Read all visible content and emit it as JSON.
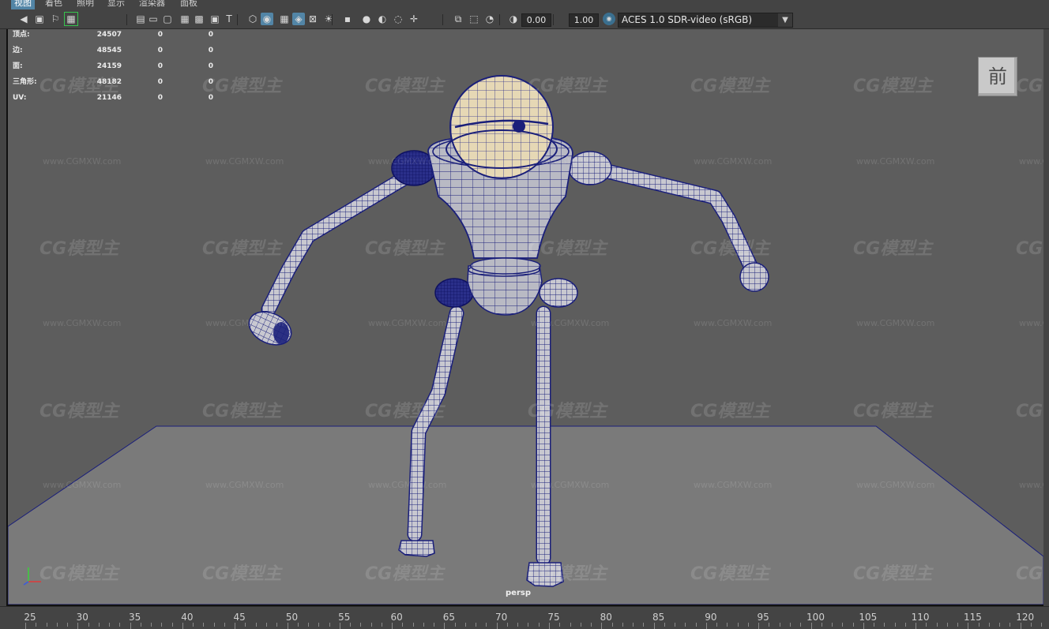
{
  "menu": {
    "items": [
      {
        "label": "视图",
        "active": true
      },
      {
        "label": "着色",
        "active": false
      },
      {
        "label": "照明",
        "active": false
      },
      {
        "label": "显示",
        "active": false
      },
      {
        "label": "渲染器",
        "active": false
      },
      {
        "label": "面板",
        "active": false
      }
    ]
  },
  "toolbar": {
    "icons": [
      "camera-icon",
      "camera-attributes-icon",
      "bookmark-icon",
      "image-plane-icon",
      "grid-icon",
      "film-gate-icon",
      "resolution-gate-icon",
      "safe-action-icon",
      "gate-mask-icon",
      "field-chart-icon",
      "safe-title-icon",
      "wireframe-icon",
      "smooth-shade-icon",
      "textured-icon",
      "shaded-wireframe-icon",
      "xray-icon",
      "lights-icon",
      "shadows-icon",
      "ambient-occlusion-icon",
      "motion-blur-icon",
      "isolate-select-icon",
      "xray-joints-icon",
      "frame-all-icon",
      "frame-selected-icon",
      "exposure-icon",
      "gamma-icon"
    ],
    "exposure_value": "0.00",
    "gamma_value": "1.00",
    "color_space": "ACES 1.0 SDR-video (sRGB)"
  },
  "hud": {
    "rows": [
      {
        "label": "顶点:",
        "v1": "24507",
        "v2": "0",
        "v3": "0"
      },
      {
        "label": "边:",
        "v1": "48545",
        "v2": "0",
        "v3": "0"
      },
      {
        "label": "面:",
        "v1": "24159",
        "v2": "0",
        "v3": "0"
      },
      {
        "label": "三角形:",
        "v1": "48182",
        "v2": "0",
        "v3": "0"
      },
      {
        "label": "UV:",
        "v1": "21146",
        "v2": "0",
        "v3": "0"
      }
    ]
  },
  "view_cube": {
    "label": "前"
  },
  "camera": {
    "label": "persp"
  },
  "watermark": {
    "logo": "CG模型主",
    "url": "www.CGMXW.com"
  },
  "timeline": {
    "ticks": [
      "25",
      "30",
      "35",
      "40",
      "45",
      "50",
      "55",
      "60",
      "65",
      "70",
      "75",
      "80",
      "85",
      "90",
      "95",
      "100",
      "105",
      "110",
      "115",
      "120"
    ]
  },
  "colors": {
    "ui_bg": "#444444",
    "viewport_bg": "#5d5d5d",
    "ground": "#7a7a7a",
    "wire": "#1a1f7a",
    "highlight": "#5285a6",
    "head_fill": "#e6d8b5"
  }
}
